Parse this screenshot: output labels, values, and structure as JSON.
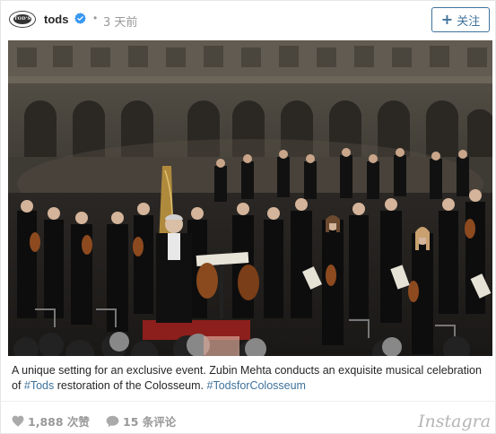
{
  "post": {
    "account": {
      "avatar_logo_text": "TOD'S",
      "username": "tods",
      "verified": true,
      "separator": "•",
      "time_ago": "3 天前"
    },
    "follow_button": {
      "plus": "+",
      "label": "关注"
    },
    "photo": {
      "alt": "Orchestra performing inside the Colosseum with Zubin Mehta conducting"
    },
    "caption": {
      "text_1": "A unique setting for an exclusive event. Zubin Mehta conducts an exquisite musical celebration of ",
      "hashtag_1": "#Tods",
      "text_2": " restoration of the Colosseum. ",
      "hashtag_2": "#TodsforColosseum"
    },
    "stats": {
      "likes_label": "1,888 次赞",
      "comments_label": "15 条评论"
    },
    "brand_wordmark": "Instagram"
  },
  "colors": {
    "link_blue": "#3f729b",
    "muted_gray": "#999999",
    "text_dark": "#262626",
    "verified_blue": "#3897f0"
  },
  "icons": {
    "verified": "verified-badge-icon",
    "like": "heart-icon",
    "comment": "comment-bubble-icon"
  }
}
